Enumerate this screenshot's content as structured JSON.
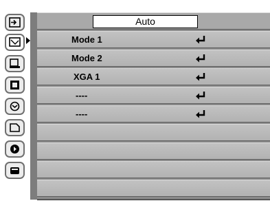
{
  "menu": {
    "title": "Auto",
    "items": [
      {
        "label": "Mode 1"
      },
      {
        "label": "Mode 2"
      },
      {
        "label": "XGA 1"
      },
      {
        "label": "----"
      },
      {
        "label": "----"
      }
    ]
  },
  "sidebar": {
    "icons": [
      "input-icon",
      "computer-adjust-icon",
      "image-select-icon",
      "image-adjust-icon",
      "screen-icon",
      "language-icon",
      "setting-icon",
      "expand-icon"
    ]
  }
}
